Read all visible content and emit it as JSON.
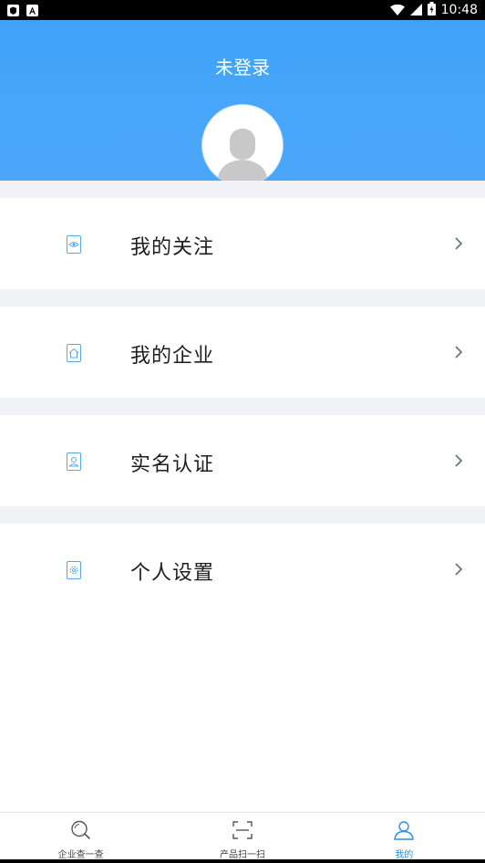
{
  "status_bar": {
    "time": "10:48",
    "left_icons": [
      "shield-notification-icon",
      "a-notification-icon"
    ],
    "right_icons": [
      "wifi-icon",
      "cell-signal-icon",
      "battery-icon"
    ]
  },
  "header": {
    "title": "未登录",
    "avatar_icon": "default-avatar-icon"
  },
  "menu": {
    "items": [
      {
        "label": "我的关注",
        "icon": "eye-icon"
      },
      {
        "label": "我的企业",
        "icon": "home-icon"
      },
      {
        "label": "实名认证",
        "icon": "id-card-icon"
      },
      {
        "label": "个人设置",
        "icon": "settings-gear-icon"
      }
    ]
  },
  "bottom_nav": {
    "items": [
      {
        "label": "企业查一查",
        "icon": "search-icon",
        "active": false
      },
      {
        "label": "产品扫一扫",
        "icon": "scan-icon",
        "active": false
      },
      {
        "label": "我的",
        "icon": "user-icon",
        "active": true
      }
    ]
  },
  "colors": {
    "header_blue": "#48a6fa",
    "accent": "#2b8de6",
    "divider_gray": "#f1f2f6"
  }
}
